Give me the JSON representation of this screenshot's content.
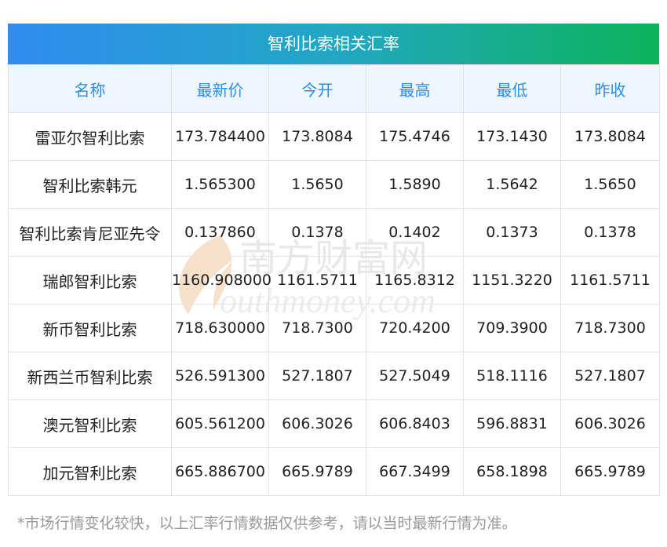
{
  "title": "智利比索相关汇率",
  "headers": [
    "名称",
    "最新价",
    "今开",
    "最高",
    "最低",
    "昨收"
  ],
  "rows": [
    [
      "雷亚尔智利比索",
      "173.784400",
      "173.8084",
      "175.4746",
      "173.1430",
      "173.8084"
    ],
    [
      "智利比索韩元",
      "1.565300",
      "1.5650",
      "1.5890",
      "1.5642",
      "1.5650"
    ],
    [
      "智利比索肯尼亚先令",
      "0.137860",
      "0.1378",
      "0.1402",
      "0.1373",
      "0.1378"
    ],
    [
      "瑞郎智利比索",
      "1160.908000",
      "1161.5711",
      "1165.8312",
      "1151.3220",
      "1161.5711"
    ],
    [
      "新币智利比索",
      "718.630000",
      "718.7300",
      "720.4200",
      "709.3900",
      "718.7300"
    ],
    [
      "新西兰币智利比索",
      "526.591300",
      "527.1807",
      "527.5049",
      "518.1116",
      "527.1807"
    ],
    [
      "澳元智利比索",
      "605.561200",
      "606.3026",
      "606.8403",
      "596.8831",
      "606.3026"
    ],
    [
      "加元智利比索",
      "665.886700",
      "665.9789",
      "667.3499",
      "658.1898",
      "665.9789"
    ]
  ],
  "note": "*市场行情变化较快，以上汇率行情数据仅供参考，请以当时最新行情为准。",
  "watermark": {
    "cn": "南方财富网",
    "en": "outhmoney.com"
  }
}
